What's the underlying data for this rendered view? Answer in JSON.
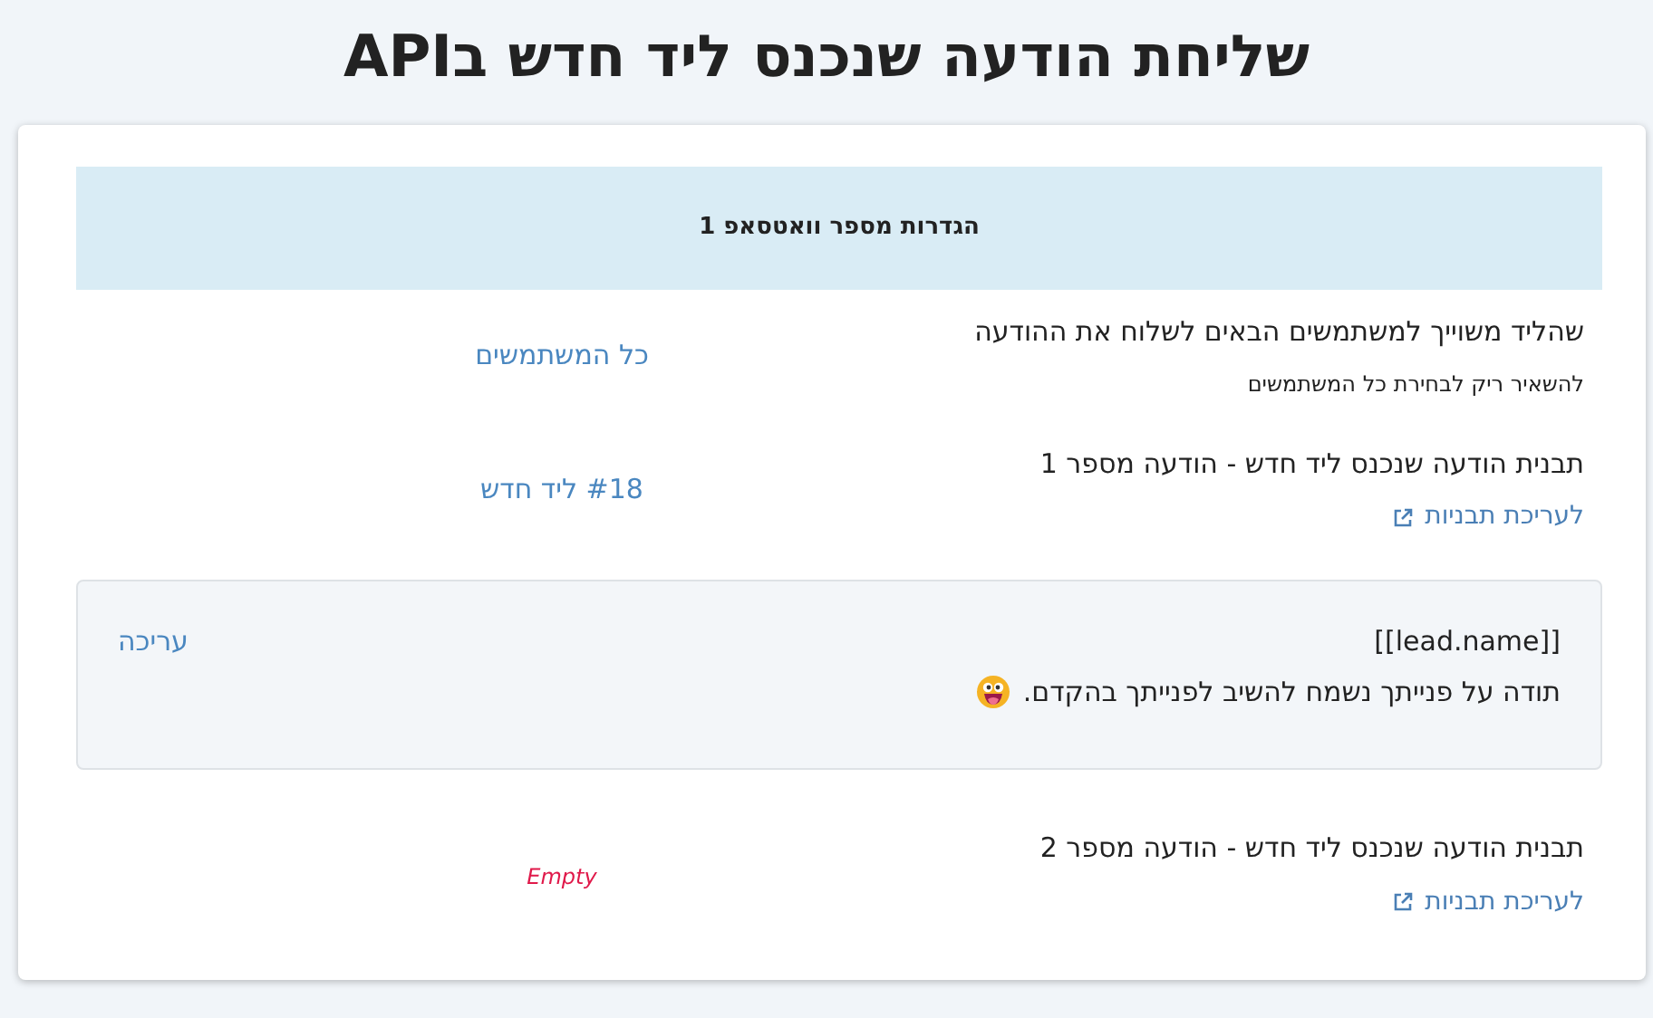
{
  "title": "שליחת הודעה שנכנס ליד חדש בAPI",
  "section": {
    "heading": "הגדרות מספר וואטסאפ 1"
  },
  "rows": [
    {
      "kind": "field",
      "label": "שהליד משוייך למשתמשים הבאים לשלוח את ההודעה",
      "hint": "להשאיר ריק לבחירת כל המשתמשים",
      "value": "כל המשתמשים",
      "empty": false
    },
    {
      "kind": "template",
      "label": "תבנית הודעה שנכנס ליד חדש - הודעה מספר 1",
      "link": "לעריכת תבניות",
      "value": "#18 ליד חדש",
      "empty": false,
      "preview": {
        "lines": [
          "[[lead.name]]",
          "תודה על פנייתך נשמח להשיב לפנייתך בהקדם."
        ],
        "action": "עריכה"
      }
    },
    {
      "kind": "template",
      "label": "תבנית הודעה שנכנס ליד חדש - הודעה מספר 2",
      "link": "לעריכת תבניות",
      "value": "Empty",
      "empty": true
    }
  ]
}
